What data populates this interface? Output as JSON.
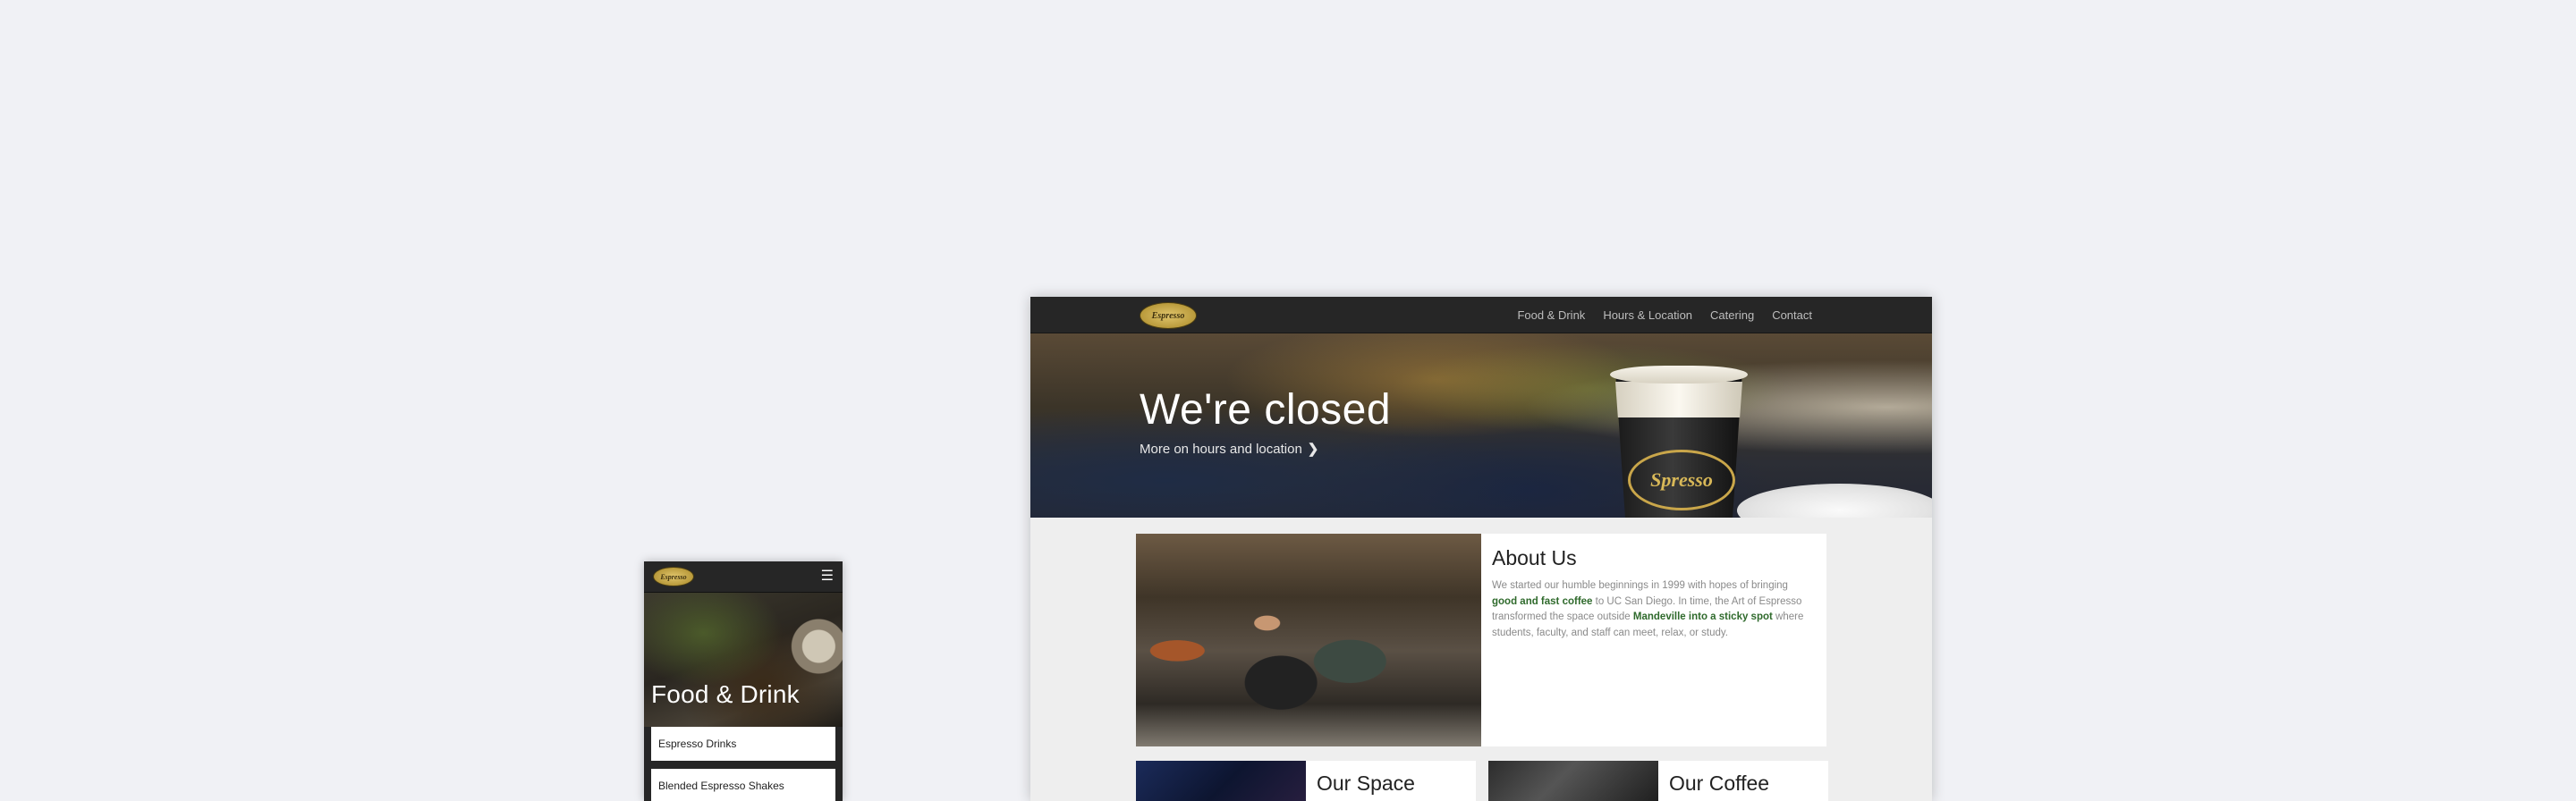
{
  "mobile": {
    "logo_text": "Espresso",
    "menu_icon": "hamburger-icon",
    "hero_title": "Food & Drink",
    "menu_items": [
      "Espresso Drinks",
      "Blended Espresso Shakes"
    ]
  },
  "desktop": {
    "logo_text": "Espresso",
    "nav": [
      "Food & Drink",
      "Hours & Location",
      "Catering",
      "Contact"
    ],
    "hero": {
      "title": "We're closed",
      "link_label": "More on hours and location",
      "link_icon": "chevron-right-icon",
      "cup_label": "Spresso"
    },
    "about": {
      "title": "About Us",
      "text_1": "We started our humble beginnings in 1999 with hopes of bringing ",
      "highlight_1": "good and fast coffee",
      "text_2": " to UC San Diego. In time, the Art of Espresso transformed the space outside ",
      "highlight_2": "Mandeville into a sticky spot",
      "text_3": " where students, faculty, and staff can meet, relax, or study."
    },
    "space": {
      "title": "Our Space"
    },
    "coffee": {
      "title": "Our Coffee"
    }
  },
  "colors": {
    "page_bg": "#f0f1f5",
    "navbar": "#262626",
    "highlight_green": "#2f6a2c",
    "logo_gold": "#c9a64a"
  }
}
